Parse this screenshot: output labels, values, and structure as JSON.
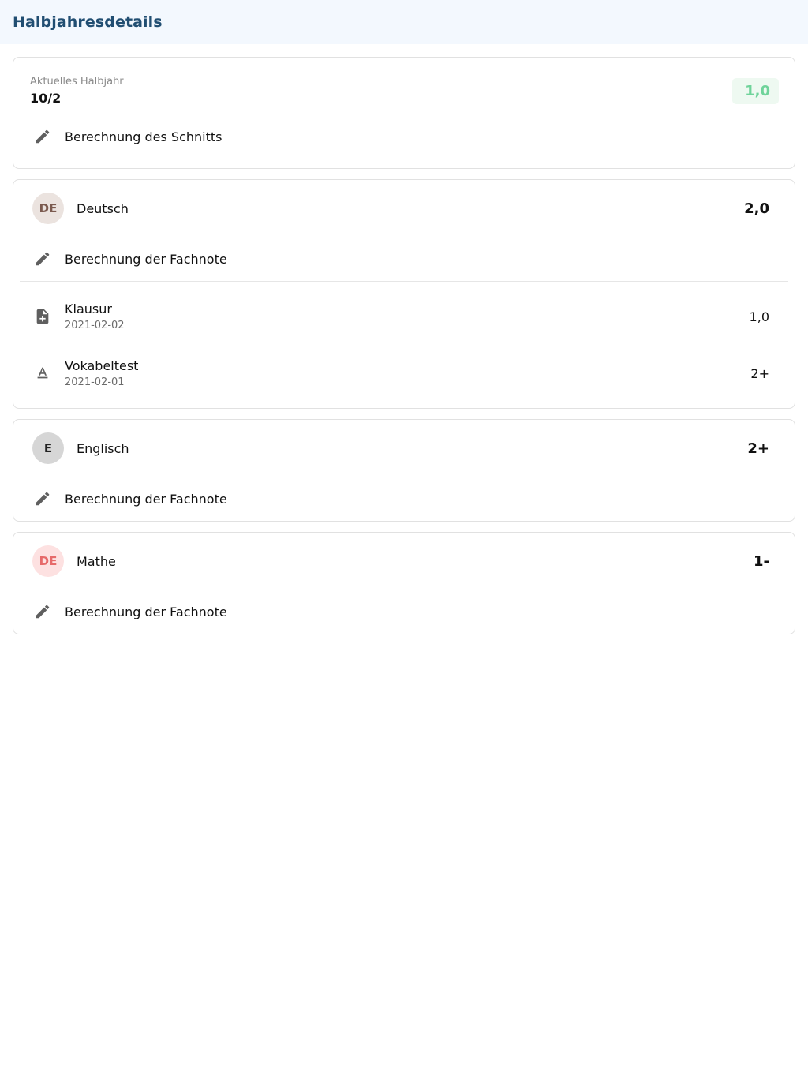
{
  "header": {
    "title": "Halbjahresdetails"
  },
  "summary": {
    "label": "Aktuelles Halbjahr",
    "value": "10/2",
    "average": "1,0",
    "calc_label": "Berechnung des Schnitts"
  },
  "subjects": [
    {
      "abbr": "DE",
      "name": "Deutsch",
      "grade": "2,0",
      "calc_label": "Berechnung der Fachnote",
      "avatar_bg": "#ebe3df",
      "avatar_fg": "#7b5a4f",
      "grades": [
        {
          "title": "Klausur",
          "date": "2021-02-02",
          "value": "1,0",
          "icon": "note-add-icon"
        },
        {
          "title": "Vokabeltest",
          "date": "2021-02-01",
          "value": "2+",
          "icon": "text-format-icon"
        }
      ]
    },
    {
      "abbr": "E",
      "name": "Englisch",
      "grade": "2+",
      "calc_label": "Berechnung der Fachnote",
      "avatar_bg": "#d6d6d6",
      "avatar_fg": "#222222"
    },
    {
      "abbr": "DE",
      "name": "Mathe",
      "grade": "1-",
      "calc_label": "Berechnung der Fachnote",
      "avatar_bg": "#fde1e1",
      "avatar_fg": "#e66a6a"
    }
  ],
  "colors": {
    "header_bg": "#f3f8fe",
    "title": "#214e72",
    "average_fg": "#6fd39a",
    "average_bg": "#eef9f1"
  }
}
